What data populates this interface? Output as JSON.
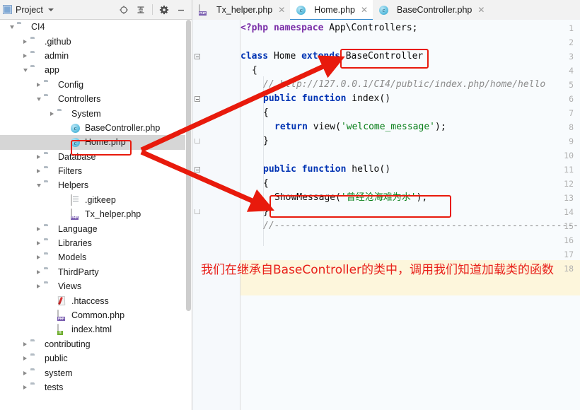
{
  "sidebar": {
    "header": {
      "title": "Project",
      "icons": [
        "project-icon",
        "chevron-down-icon",
        "locate-icon",
        "collapse-all-icon",
        "settings-icon",
        "minimize-icon"
      ]
    },
    "tree": [
      {
        "label": "CI4",
        "depth": 0,
        "toggle": "down",
        "icon": "folder"
      },
      {
        "label": ".github",
        "depth": 1,
        "toggle": "right",
        "icon": "folder"
      },
      {
        "label": "admin",
        "depth": 1,
        "toggle": "right",
        "icon": "folder"
      },
      {
        "label": "app",
        "depth": 1,
        "toggle": "down",
        "icon": "folder"
      },
      {
        "label": "Config",
        "depth": 2,
        "toggle": "right",
        "icon": "folder"
      },
      {
        "label": "Controllers",
        "depth": 2,
        "toggle": "down",
        "icon": "folder"
      },
      {
        "label": "System",
        "depth": 3,
        "toggle": "right",
        "icon": "folder"
      },
      {
        "label": "BaseController.php",
        "depth": 4,
        "toggle": "none",
        "icon": "class"
      },
      {
        "label": "Home.php",
        "depth": 4,
        "toggle": "none",
        "icon": "class",
        "selected": true
      },
      {
        "label": "Database",
        "depth": 2,
        "toggle": "right",
        "icon": "folder"
      },
      {
        "label": "Filters",
        "depth": 2,
        "toggle": "right",
        "icon": "folder"
      },
      {
        "label": "Helpers",
        "depth": 2,
        "toggle": "down",
        "icon": "folder"
      },
      {
        "label": ".gitkeep",
        "depth": 4,
        "toggle": "none",
        "icon": "txt"
      },
      {
        "label": "Tx_helper.php",
        "depth": 4,
        "toggle": "none",
        "icon": "php"
      },
      {
        "label": "Language",
        "depth": 2,
        "toggle": "right",
        "icon": "folder"
      },
      {
        "label": "Libraries",
        "depth": 2,
        "toggle": "right",
        "icon": "folder"
      },
      {
        "label": "Models",
        "depth": 2,
        "toggle": "right",
        "icon": "folder"
      },
      {
        "label": "ThirdParty",
        "depth": 2,
        "toggle": "right",
        "icon": "folder"
      },
      {
        "label": "Views",
        "depth": 2,
        "toggle": "right",
        "icon": "folder"
      },
      {
        "label": ".htaccess",
        "depth": 3,
        "toggle": "none",
        "icon": "htaccess"
      },
      {
        "label": "Common.php",
        "depth": 3,
        "toggle": "none",
        "icon": "php"
      },
      {
        "label": "index.html",
        "depth": 3,
        "toggle": "none",
        "icon": "html"
      },
      {
        "label": "contributing",
        "depth": 1,
        "toggle": "right",
        "icon": "folder"
      },
      {
        "label": "public",
        "depth": 1,
        "toggle": "right",
        "icon": "folder"
      },
      {
        "label": "system",
        "depth": 1,
        "toggle": "right",
        "icon": "folder"
      },
      {
        "label": "tests",
        "depth": 1,
        "toggle": "right",
        "icon": "folder"
      }
    ]
  },
  "editor": {
    "tabs": [
      {
        "label": "Tx_helper.php",
        "icon": "php",
        "active": false,
        "closable": true
      },
      {
        "label": "Home.php",
        "icon": "class",
        "active": true,
        "closable": true
      },
      {
        "label": "BaseController.php",
        "icon": "class",
        "active": false,
        "closable": true
      }
    ],
    "line_numbers": [
      "1",
      "2",
      "3",
      "4",
      "5",
      "6",
      "7",
      "8",
      "9",
      "10",
      "11",
      "12",
      "13",
      "14",
      "15",
      "16",
      "17",
      "18"
    ],
    "lines": [
      {
        "n": 1,
        "indent": 0,
        "tokens": [
          {
            "t": "<?php ",
            "c": "kwp"
          },
          {
            "t": "namespace ",
            "c": "kwp"
          },
          {
            "t": "App\\Controllers;",
            "c": "plain"
          }
        ]
      },
      {
        "n": 2,
        "indent": 0,
        "tokens": []
      },
      {
        "n": 3,
        "indent": 0,
        "fold": "open",
        "tokens": [
          {
            "t": "class ",
            "c": "kw"
          },
          {
            "t": "Home ",
            "c": "plain"
          },
          {
            "t": "extends ",
            "c": "kw"
          },
          {
            "t": "BaseController",
            "c": "plain"
          }
        ]
      },
      {
        "n": 4,
        "indent": 1,
        "tokens": [
          {
            "t": "{",
            "c": "plain"
          }
        ]
      },
      {
        "n": 5,
        "indent": 2,
        "tokens": [
          {
            "t": "// http://127.0.0.1/CI4/public/index.php/home/hello",
            "c": "cmt"
          }
        ]
      },
      {
        "n": 6,
        "indent": 2,
        "fold": "open",
        "tokens": [
          {
            "t": "public ",
            "c": "kw"
          },
          {
            "t": "function ",
            "c": "kw"
          },
          {
            "t": "index()",
            "c": "plain"
          }
        ]
      },
      {
        "n": 7,
        "indent": 2,
        "tokens": [
          {
            "t": "{",
            "c": "plain"
          }
        ]
      },
      {
        "n": 8,
        "indent": 3,
        "tokens": [
          {
            "t": "return ",
            "c": "kw"
          },
          {
            "t": "view(",
            "c": "plain"
          },
          {
            "t": "'welcome_message'",
            "c": "str"
          },
          {
            "t": ");",
            "c": "plain"
          }
        ]
      },
      {
        "n": 9,
        "indent": 2,
        "fold": "close",
        "tokens": [
          {
            "t": "}",
            "c": "plain"
          }
        ]
      },
      {
        "n": 10,
        "indent": 0,
        "tokens": []
      },
      {
        "n": 11,
        "indent": 2,
        "fold": "open",
        "tokens": [
          {
            "t": "public ",
            "c": "kw"
          },
          {
            "t": "function ",
            "c": "kw"
          },
          {
            "t": "hello()",
            "c": "plain"
          }
        ]
      },
      {
        "n": 12,
        "indent": 2,
        "tokens": [
          {
            "t": "{",
            "c": "plain"
          }
        ]
      },
      {
        "n": 13,
        "indent": 3,
        "tokens": [
          {
            "t": "ShowMessage(",
            "c": "plain"
          },
          {
            "t": "'曾经沧海难为水'",
            "c": "str"
          },
          {
            "t": ");",
            "c": "plain"
          }
        ]
      },
      {
        "n": 14,
        "indent": 2,
        "fold": "close",
        "tokens": [
          {
            "t": "}",
            "c": "plain"
          }
        ]
      },
      {
        "n": 15,
        "indent": 2,
        "tokens": [
          {
            "t": "//-------------------------------------------------------",
            "c": "cmt"
          }
        ]
      },
      {
        "n": 16,
        "indent": 0,
        "tokens": []
      },
      {
        "n": 17,
        "indent": 0,
        "tokens": []
      },
      {
        "n": 18,
        "indent": 0,
        "tokens": []
      }
    ]
  },
  "annotations": {
    "box_basecontroller_label": "BaseController",
    "box_showmessage_label": "ShowMessage('曾经沧海难为水');",
    "box_home_php_label": "Home.php",
    "note_text": "我们在继承自BaseController的类中，调用我们知道加载类的函数",
    "accent_color": "#e81a0c",
    "note_color": "#e8201a",
    "highlight_color": "#fdf6dc"
  }
}
